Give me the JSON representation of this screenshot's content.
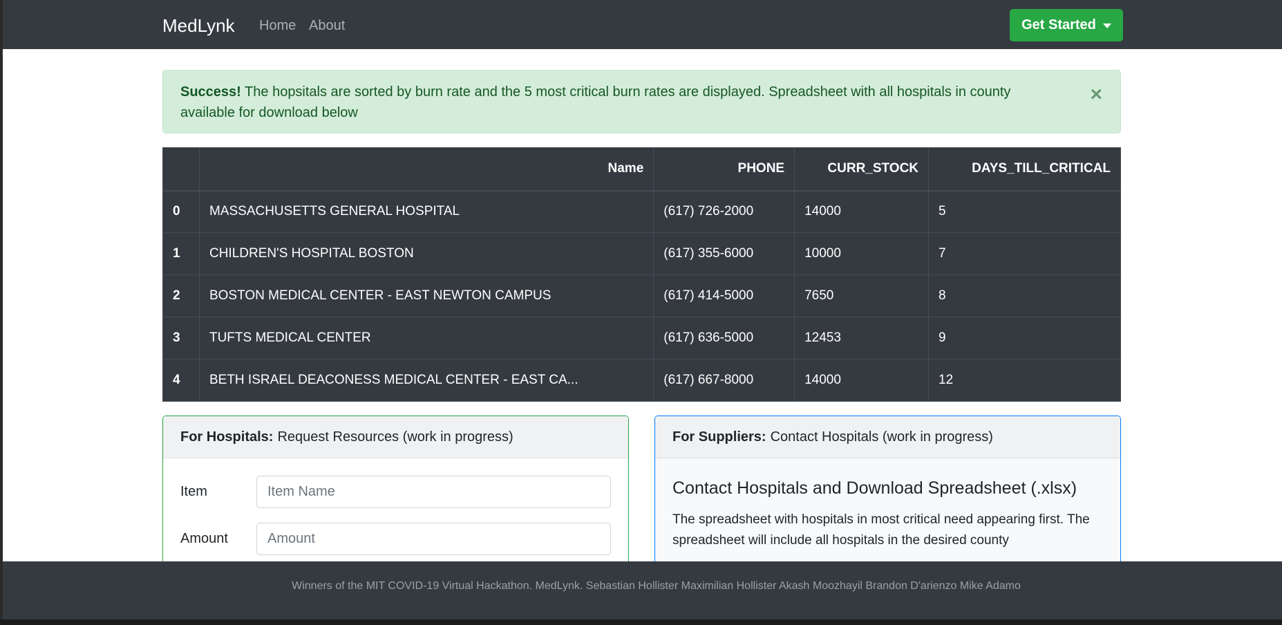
{
  "nav": {
    "brand": "MedLynk",
    "links": [
      "Home",
      "About"
    ],
    "cta_label": "Get Started"
  },
  "alert": {
    "strong": "Success!",
    "message": "The hopsitals are sorted by burn rate and the 5 most critical burn rates are displayed. Spreadsheet with all hospitals in county available for download below",
    "close": "×"
  },
  "table": {
    "headers": [
      "",
      "Name",
      "PHONE",
      "CURR_STOCK",
      "DAYS_TILL_CRITICAL"
    ],
    "rows": [
      {
        "idx": "0",
        "name": "MASSACHUSETTS GENERAL HOSPITAL",
        "phone": "(617) 726-2000",
        "stock": "14000",
        "days": "5"
      },
      {
        "idx": "1",
        "name": "CHILDREN'S HOSPITAL BOSTON",
        "phone": "(617) 355-6000",
        "stock": "10000",
        "days": "7"
      },
      {
        "idx": "2",
        "name": "BOSTON MEDICAL CENTER - EAST NEWTON CAMPUS",
        "phone": "(617) 414-5000",
        "stock": "7650",
        "days": "8"
      },
      {
        "idx": "3",
        "name": "TUFTS MEDICAL CENTER",
        "phone": "(617) 636-5000",
        "stock": "12453",
        "days": "9"
      },
      {
        "idx": "4",
        "name": "BETH ISRAEL DEACONESS MEDICAL CENTER - EAST CA...",
        "phone": "(617) 667-8000",
        "stock": "14000",
        "days": "12"
      }
    ]
  },
  "hospitals_card": {
    "header_strong": "For Hospitals:",
    "header_text": "Request Resources (work in progress)",
    "item_label": "Item",
    "item_placeholder": "Item Name",
    "amount_label": "Amount",
    "amount_placeholder": "Amount"
  },
  "suppliers_card": {
    "header_strong": "For Suppliers:",
    "header_text": "Contact Hospitals (work in progress)",
    "title": "Contact Hospitals and Download Spreadsheet (.xlsx)",
    "text": "The spreadsheet with hospitals in most critical need appearing first. The spreadsheet will include all hospitals in the desired county"
  },
  "footer": {
    "text": "Winners of the MIT COVID-19 Virtual Hackathon. MedLynk. Sebastian Hollister Maximilian Hollister Akash Moozhayil Brandon D'arienzo Mike Adamo"
  },
  "colors": {
    "navbar": "#343a40",
    "success": "#28a745",
    "primary": "#007bff",
    "alert_bg": "#d4edda",
    "alert_text": "#155724"
  }
}
